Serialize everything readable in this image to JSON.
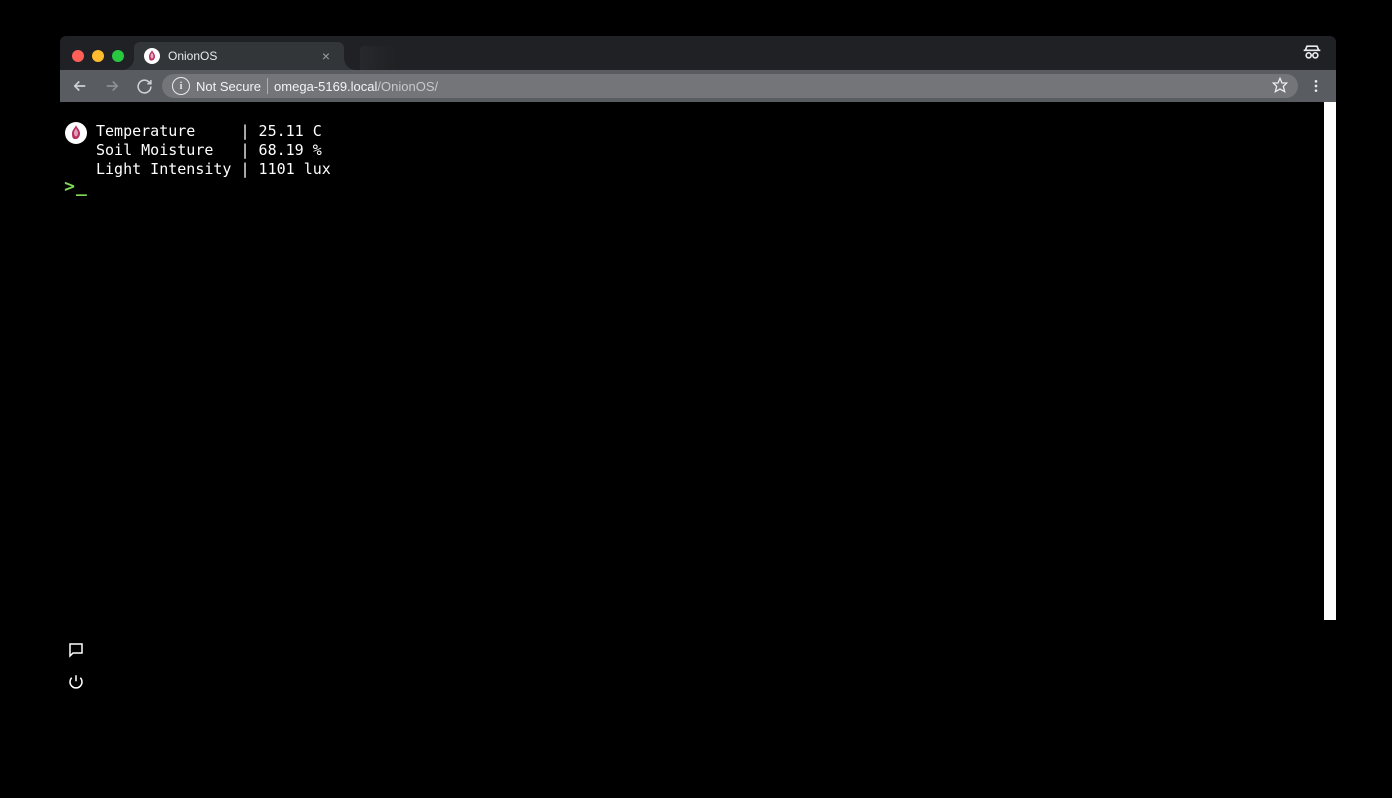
{
  "tab": {
    "title": "OnionOS"
  },
  "addressbar": {
    "security_label": "Not Secure",
    "host": "omega-5169.local",
    "path": "/OnionOS/"
  },
  "terminal": {
    "rows": [
      {
        "label": "Temperature",
        "value": "25.11 C"
      },
      {
        "label": "Soil Moisture",
        "value": "68.19 %"
      },
      {
        "label": "Light Intensity",
        "value": "1101 lux"
      }
    ],
    "prompt": ">_"
  }
}
